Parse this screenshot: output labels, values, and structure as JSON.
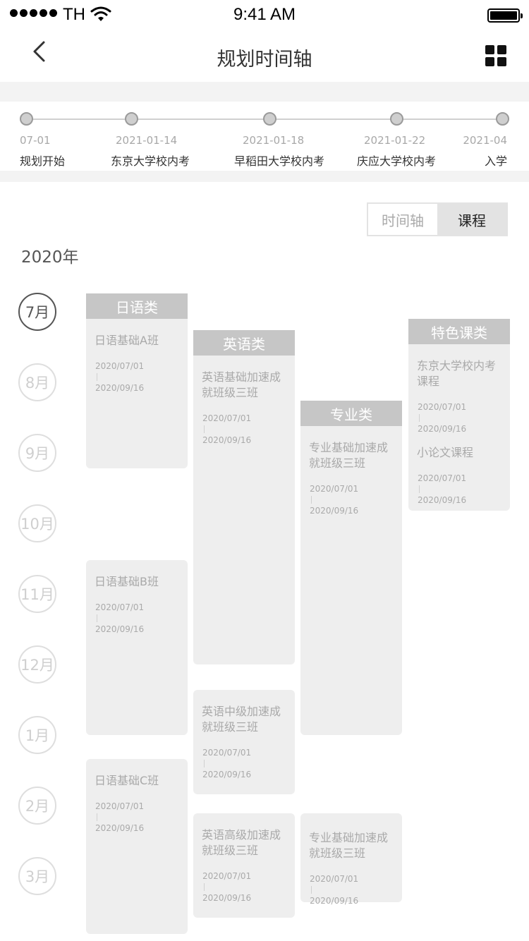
{
  "status_bar": {
    "carrier": "TH",
    "time": "9:41 AM"
  },
  "nav": {
    "title": "规划时间轴"
  },
  "timeline": [
    {
      "date": "07-01",
      "label": "规划开始"
    },
    {
      "date": "2021-01-14",
      "label": "东京大学校内考"
    },
    {
      "date": "2021-01-18",
      "label": "早稻田大学校内考"
    },
    {
      "date": "2021-01-22",
      "label": "庆应大学校内考"
    },
    {
      "date": "2021-04",
      "label": "入学"
    }
  ],
  "toggle": {
    "timeline_label": "时间轴",
    "course_label": "课程",
    "selected": "课程"
  },
  "year": "2020年",
  "months": [
    "7月",
    "8月",
    "9月",
    "10月",
    "11月",
    "12月",
    "1月",
    "2月",
    "3月"
  ],
  "active_month": "7月",
  "categories": [
    {
      "name": "日语类"
    },
    {
      "name": "英语类"
    },
    {
      "name": "专业类"
    },
    {
      "name": "特色课类"
    }
  ],
  "cards": {
    "japanese_a": {
      "name": "日语基础A班",
      "start": "2020/07/01",
      "end": "2020/09/16"
    },
    "japanese_b": {
      "name": "日语基础B班",
      "start": "2020/07/01",
      "end": "2020/09/16"
    },
    "japanese_c": {
      "name": "日语基础C班",
      "start": "2020/07/01",
      "end": "2020/09/16"
    },
    "english_basic": {
      "name": "英语基础加速成就班级三班",
      "start": "2020/07/01",
      "end": "2020/09/16"
    },
    "english_mid": {
      "name": "英语中级加速成就班级三班",
      "start": "2020/07/01",
      "end": "2020/09/16"
    },
    "english_adv": {
      "name": "英语高级加速成就班级三班",
      "start": "2020/07/01",
      "end": "2020/09/16"
    },
    "major_1": {
      "name": "专业基础加速成就班级三班",
      "start": "2020/07/01",
      "end": "2020/09/16"
    },
    "major_2": {
      "name": "专业基础加速成就班级三班",
      "start": "2020/07/01",
      "end": "2020/09/16"
    },
    "special_tokyo": {
      "name": "东京大学校内考课程",
      "start": "2020/07/01",
      "end": "2020/09/16"
    },
    "special_essay": {
      "name": "小论文课程",
      "start": "2020/07/01",
      "end": "2020/09/16"
    }
  },
  "colors": {
    "category_header": "#c6c6c6",
    "card_bg": "#eeeeee",
    "band": "#f3f3f3"
  }
}
